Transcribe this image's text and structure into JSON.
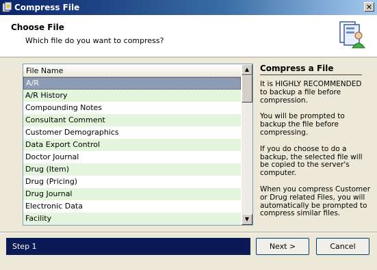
{
  "window": {
    "title": "Compress File",
    "close_label": "✕"
  },
  "header": {
    "title": "Choose File",
    "subtitle": "Which file do you want to compress?"
  },
  "file_list": {
    "column_header": "File Name",
    "rows": [
      "A/R",
      "A/R History",
      "Compounding Notes",
      "Consultant Comment",
      "Customer Demographics",
      "Data Export Control",
      "Doctor Journal",
      "Drug (Item)",
      "Drug (Pricing)",
      "Drug Journal",
      "Electronic Data",
      "Facility"
    ],
    "selected": "A/R"
  },
  "info": {
    "title": "Compress a File",
    "paragraphs": [
      "It is HIGHLY RECOMMENDED to backup a file before compression.",
      "You will be prompted to backup the file before compressing.",
      "If you do choose to do a backup, the selected file will be copied to the server's computer.",
      "When you compress Customer or Drug related Files, you will automatically be prompted to compress similar files."
    ]
  },
  "footer": {
    "step_label": "Step 1",
    "next_label": "Next >",
    "cancel_label": "Cancel"
  },
  "colors": {
    "title_bar": "#0a246a",
    "step_bar": "#0a1a56",
    "row_alt": "#e3f5dc",
    "row_selected": "#8e9bb5"
  }
}
